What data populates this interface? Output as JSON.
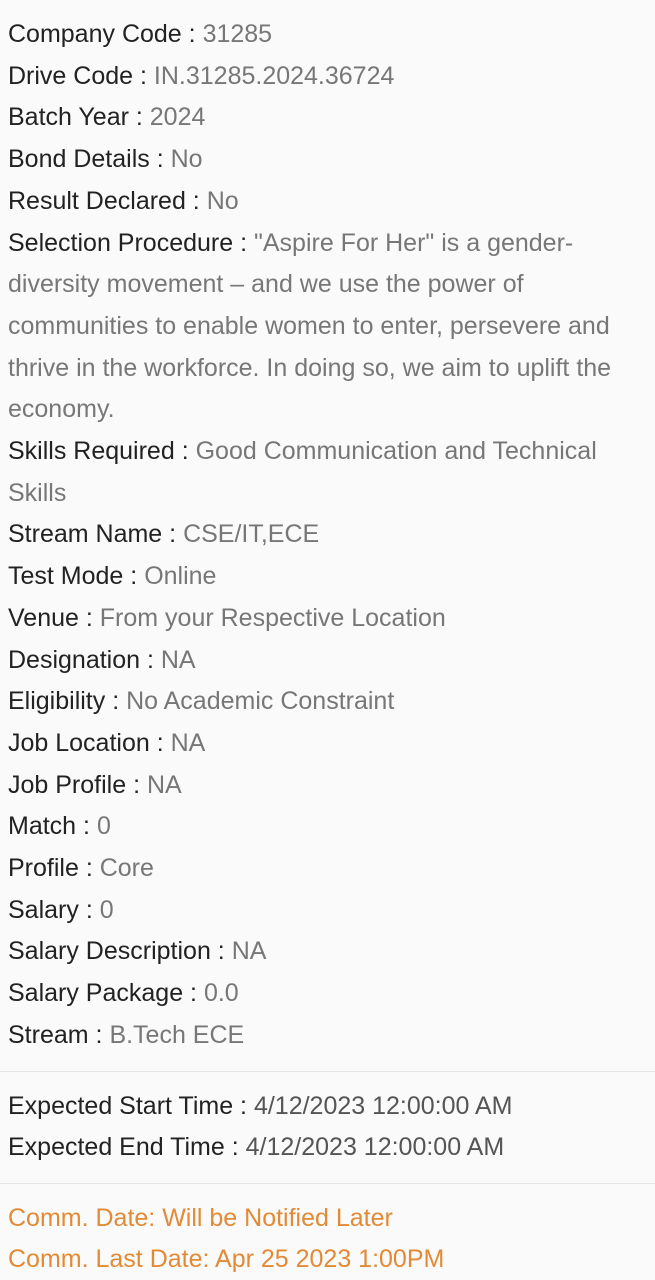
{
  "details": [
    {
      "label": "Company Code",
      "value": "31285"
    },
    {
      "label": "Drive Code",
      "value": "IN.31285.2024.36724"
    },
    {
      "label": "Batch Year",
      "value": "2024"
    },
    {
      "label": "Bond Details",
      "value": "No"
    },
    {
      "label": "Result Declared",
      "value": "No"
    },
    {
      "label": "Selection Procedure",
      "value": "\"Aspire For Her\" is a gender-diversity movement – and we use the power of communities to enable women to enter, persevere and thrive in the workforce. In doing so, we aim to uplift the economy."
    },
    {
      "label": "Skills Required",
      "value": "Good Communication and Technical Skills"
    },
    {
      "label": "Stream Name",
      "value": "CSE/IT,ECE"
    },
    {
      "label": "Test Mode",
      "value": "Online"
    },
    {
      "label": "Venue",
      "value": "From your Respective Location"
    },
    {
      "label": "Designation",
      "value": "NA"
    },
    {
      "label": "Eligibility",
      "value": "No Academic Constraint"
    },
    {
      "label": "Job Location",
      "value": "NA"
    },
    {
      "label": "Job Profile",
      "value": "NA"
    },
    {
      "label": "Match",
      "value": "0"
    },
    {
      "label": "Profile",
      "value": "Core"
    },
    {
      "label": "Salary",
      "value": "0"
    },
    {
      "label": "Salary Description",
      "value": "NA"
    },
    {
      "label": "Salary Package",
      "value": "0.0"
    },
    {
      "label": "Stream",
      "value": "B.Tech ECE"
    }
  ],
  "times": [
    {
      "label": "Expected Start Time",
      "value": "4/12/2023 12:00:00 AM"
    },
    {
      "label": "Expected End Time",
      "value": "4/12/2023 12:00:00 AM"
    }
  ],
  "comm": {
    "date": "Comm. Date: Will be Notified Later",
    "last_date": "Comm. Last Date: Apr 25 2023 1:00PM"
  },
  "colors": {
    "label": "#222222",
    "value": "#777777",
    "accent": "#e28a36",
    "background": "#fafafa"
  }
}
